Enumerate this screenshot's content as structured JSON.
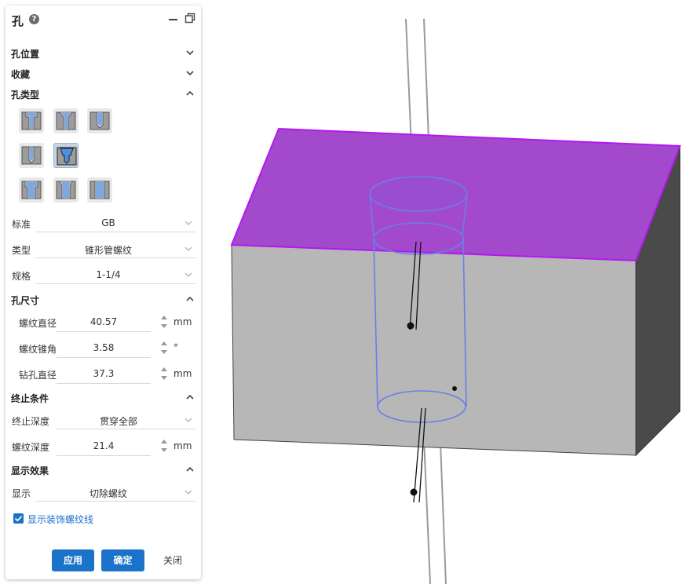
{
  "panel": {
    "title": "孔",
    "help": "?",
    "sections": {
      "position": "孔位置",
      "favorites": "收藏",
      "hole_type": "孔类型",
      "hole_size": "孔尺寸",
      "end_condition": "终止条件",
      "display_effect": "显示效果"
    },
    "hole_type_icons": [
      "counterbore-hole-icon",
      "countersink-hole-icon",
      "threaded-hole-icon",
      "simple-hole-icon",
      "tapered-pipe-thread-hole-icon",
      "counterbore-slot-icon",
      "countersink-slot-icon",
      "straight-slot-icon"
    ],
    "standard": {
      "label": "标准",
      "value": "GB"
    },
    "type": {
      "label": "类型",
      "value": "锥形管螺纹"
    },
    "spec": {
      "label": "规格",
      "value": "1-1/4"
    },
    "thread_diameter": {
      "label": "螺纹直径",
      "value": "40.57",
      "unit": "mm"
    },
    "thread_taper": {
      "label": "螺纹锥角",
      "value": "3.58",
      "unit": "°"
    },
    "drill_diameter": {
      "label": "钻孔直径",
      "value": "37.3",
      "unit": "mm"
    },
    "end_depth": {
      "label": "终止深度",
      "value": "贯穿全部"
    },
    "thread_depth": {
      "label": "螺纹深度",
      "value": "21.4",
      "unit": "mm"
    },
    "display": {
      "label": "显示",
      "value": "切除螺纹"
    },
    "show_cosmetic": {
      "label": "显示装饰螺纹线",
      "checked": true
    },
    "buttons": {
      "apply": "应用",
      "ok": "确定",
      "close": "关闭"
    }
  },
  "colors": {
    "accent": "#1a73c8",
    "top_face": "#a349cc",
    "top_edge": "#b318f0",
    "front_face": "#b7b7b7",
    "side_face": "#4a4a4a",
    "hole_edge": "#6b7ee6"
  }
}
